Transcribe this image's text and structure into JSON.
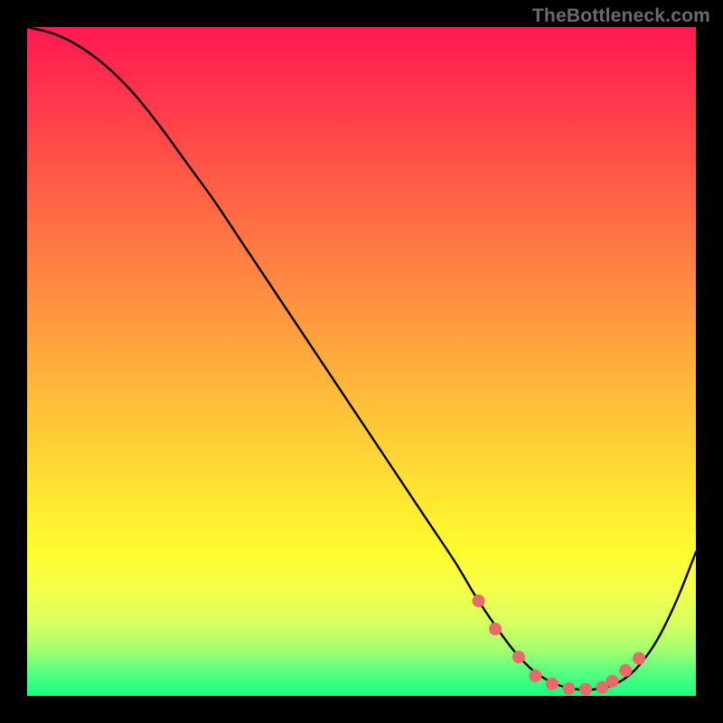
{
  "watermark": "TheBottleneck.com",
  "chart_data": {
    "type": "line",
    "title": "",
    "xlabel": "",
    "ylabel": "",
    "xlim": [
      0,
      100
    ],
    "ylim": [
      0,
      100
    ],
    "grid": false,
    "legend": false,
    "series": [
      {
        "name": "curve",
        "color": "#000000",
        "x": [
          0,
          4,
          8,
          12,
          16,
          20,
          24,
          28,
          32,
          36,
          40,
          44,
          48,
          52,
          56,
          60,
          64,
          67,
          70,
          73,
          76,
          79,
          82,
          85,
          88,
          91,
          94,
          97,
          100
        ],
        "y": [
          100,
          99,
          97,
          94,
          90,
          85,
          79.5,
          74,
          68,
          62,
          56,
          50,
          44,
          38,
          32,
          26,
          20,
          15,
          10.5,
          6.5,
          3.5,
          1.8,
          1.0,
          1.0,
          1.8,
          4.0,
          8.0,
          14.0,
          21.5
        ]
      }
    ],
    "markers": {
      "name": "dots",
      "color": "#e96a6a",
      "radius_pct": 0.95,
      "x": [
        67.5,
        70.0,
        73.5,
        76.0,
        78.5,
        81.0,
        83.5,
        86.0,
        87.5,
        89.5,
        91.5
      ],
      "y": [
        14.2,
        10.0,
        5.8,
        3.0,
        1.8,
        1.1,
        1.0,
        1.3,
        2.2,
        3.8,
        5.6
      ]
    }
  }
}
